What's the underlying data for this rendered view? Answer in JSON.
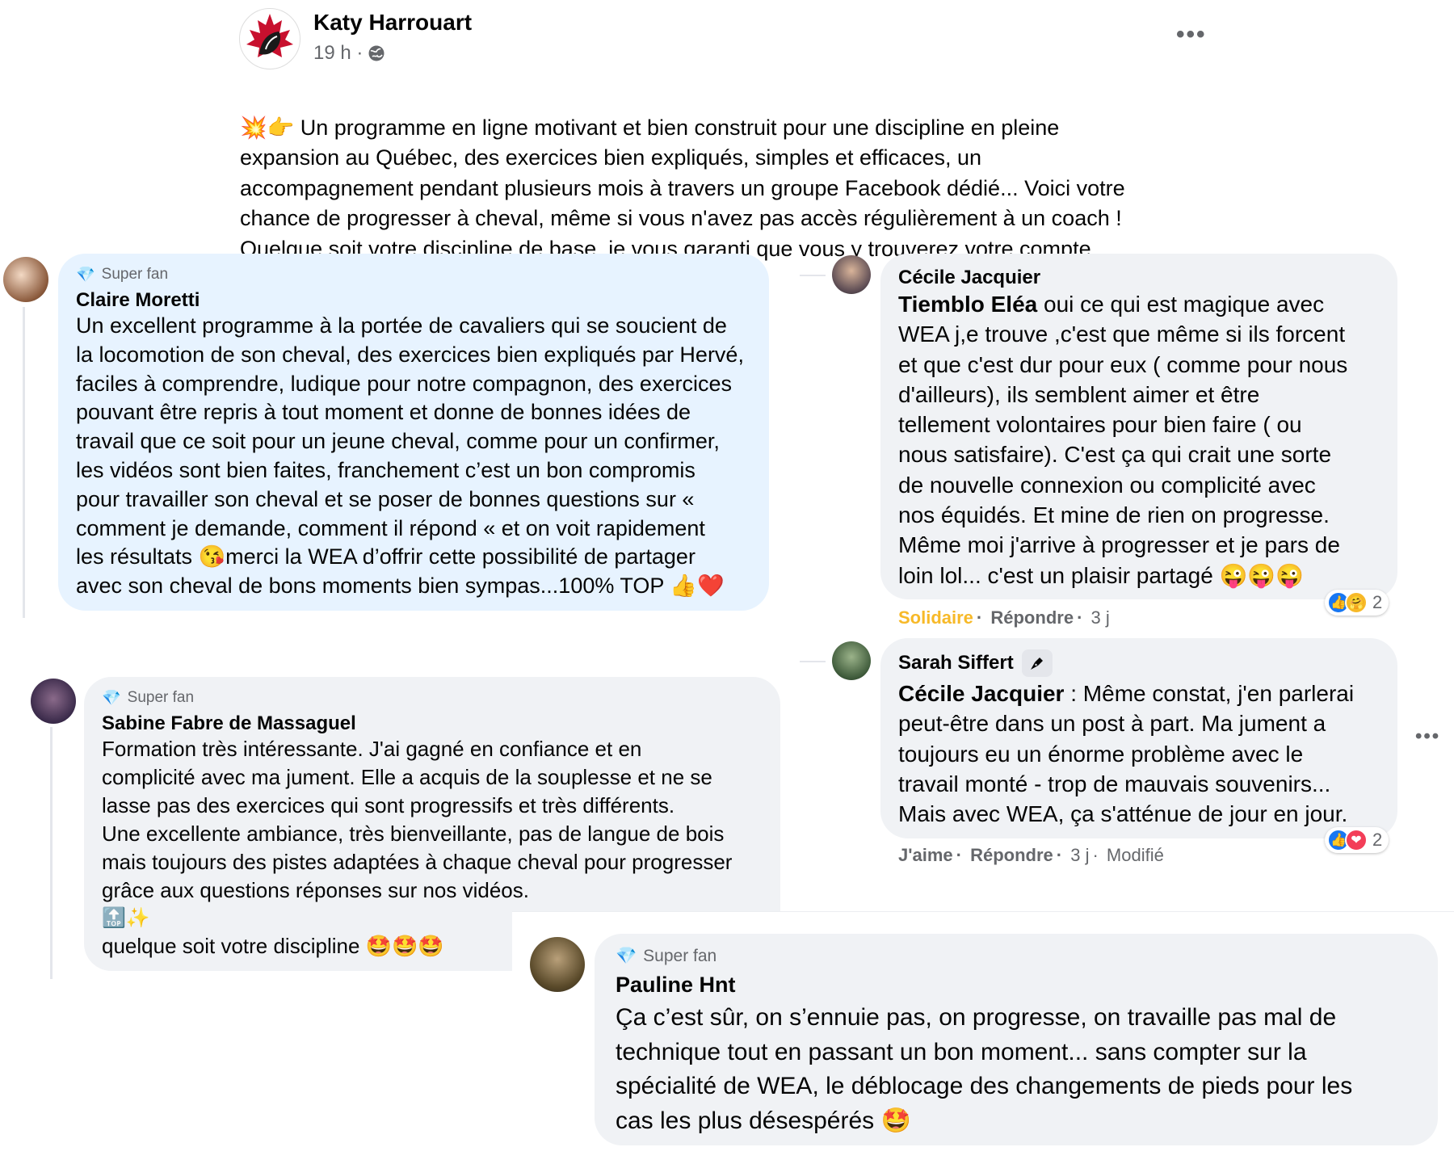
{
  "post": {
    "author": "Katy Harrouart",
    "time": "19 h ·",
    "lead_emojis": "💥👉",
    "text": "Un programme en ligne motivant et bien construit pour une discipline en pleine\nexpansion au Québec, des exercices bien expliqués, simples et efficaces, un\naccompagnement pendant plusieurs mois à travers un groupe Facebook dédié... Voici votre\nchance de progresser à cheval, même si vous n'avez pas accès régulièrement à un coach !\nQuelque soit votre discipline de base, je vous garanti que vous y trouverez votre compte.",
    "more": "•••"
  },
  "comments": {
    "claire": {
      "badge": "Super fan",
      "name": "Claire Moretti",
      "text": "Un excellent programme à la portée de cavaliers qui se soucient de\nla locomotion de son cheval, des exercices bien expliqués par Hervé,\nfaciles à comprendre, ludique pour notre compagnon, des exercices\npouvant être repris à tout moment et donne de bonnes idées de\ntravail que ce soit pour un jeune cheval, comme pour un confirmer,\nles vidéos sont bien faites, franchement c’est un bon compromis\npour travailler son cheval et se poser de bonnes questions sur «\ncomment je demande, comment il répond « et on voit rapidement\nles résultats 😘merci la WEA d’offrir cette possibilité de partager\navec son cheval de bons moments bien sympas...100% TOP 👍❤️"
    },
    "cecile": {
      "name": "Cécile Jacquier",
      "mention": "Tiemblo Eléa",
      "text": " oui ce qui est magique avec\nWEA j,e trouve ,c'est que même si ils forcent\net que c'est dur pour eux ( comme pour nous\nd'ailleurs), ils semblent aimer et être\ntellement volontaires pour bien faire ( ou\nnous satisfaire). C'est ça qui crait une sorte\nde nouvelle connexion ou complicité avec\nnos équidés. Et mine de rien on progresse.\nMême moi j'arrive à progresser et je pars de\nloin lol... c'est un plaisir partagé 😜😜😜",
      "action_react": "Solidaire",
      "action_reply": "Répondre",
      "time": "3 j",
      "reactions": [
        "👍",
        "🤗"
      ],
      "reaction_count": "2"
    },
    "sarah": {
      "name": "Sarah Siffert",
      "mention": "Cécile Jacquier",
      "text": " : Même constat, j'en parlerai\npeut-être dans un post à part. Ma jument a\ntoujours eu un énorme problème avec le\ntravail monté - trop de mauvais souvenirs...\nMais avec WEA, ça s'atténue de jour en jour.",
      "action_like": "J'aime",
      "action_reply": "Répondre",
      "time": "3 j",
      "edited": "Modifié",
      "reactions": [
        "👍",
        "❤"
      ],
      "reaction_count": "2",
      "more": "•••"
    },
    "sabine": {
      "badge": "Super fan",
      "name": "Sabine Fabre de Massaguel",
      "text": "Formation très intéressante. J'ai gagné en confiance et en\ncomplicité avec ma jument. Elle a acquis de la souplesse et ne se\nlasse pas des exercices qui sont progressifs et très différents.\nUne excellente ambiance, très bienveillante, pas de langue de bois\nmais toujours des pistes adaptées à chaque cheval pour progresser\ngrâce aux questions réponses sur nos vidéos.",
      "emoji_line": "🔝✨",
      "last_line": "quelque soit votre discipline 🤩🤩🤩"
    },
    "pauline": {
      "badge": "Super fan",
      "name": "Pauline Hnt",
      "text": "Ça c’est sûr, on s’ennuie pas, on progresse, on travaille pas mal de\ntechnique tout en passant un bon moment... sans compter sur la\nspécialité de WEA, le déblocage des changements de pieds pour les\ncas les plus désespérés 🤩"
    }
  },
  "colors": {
    "bubble_gray": "#f0f2f5",
    "bubble_blue": "#e7f3ff",
    "secondary_text": "#65676b",
    "solidaire": "#f7b928",
    "like_blue": "#1877f2",
    "love_red": "#f33e58"
  }
}
